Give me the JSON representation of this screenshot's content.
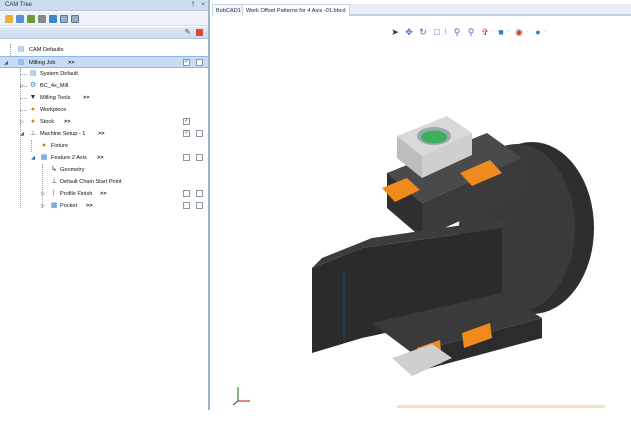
{
  "panel": {
    "title": "CAM Tree",
    "pin": "†",
    "close": "×"
  },
  "toolbar": {
    "icons": [
      "generate-icon",
      "tree-icon",
      "posted-icon",
      "tool-icon",
      "simulate-icon",
      "grid-icon",
      "list-icon"
    ]
  },
  "tree": {
    "rows": [
      {
        "label": "CAM Defaults"
      },
      {
        "label": "Milling Job",
        "arrow": ">>"
      },
      {
        "label": "System Default"
      },
      {
        "label": "BC_4x_Mill"
      },
      {
        "label": "Milling Tools",
        "arrow": ">>"
      },
      {
        "label": "Workpiece"
      },
      {
        "label": "Stock",
        "arrow": ">>"
      },
      {
        "label": "Machine Setup - 1",
        "arrow": ">>"
      },
      {
        "label": "Fixture"
      },
      {
        "label": "Feature 2 Axis",
        "arrow": ">>"
      },
      {
        "label": "Geometry"
      },
      {
        "label": "Default Chain Start Point"
      },
      {
        "label": "Profile Finish",
        "arrow": ">>"
      },
      {
        "label": "Pocket",
        "arrow": ">>"
      }
    ]
  },
  "tabs": [
    {
      "label": "BobCAD1"
    },
    {
      "label": "Work Offset Patterns for 4 Axis -01.bbcd"
    }
  ],
  "view_toolbar": {
    "icons": [
      "select-arrow-icon",
      "pan-icon",
      "rotate-icon",
      "zoom-window-icon",
      "zoom-icon",
      "zoom-fit-icon",
      "view-cube-icon",
      "shaded-icon",
      "render-mode-icon",
      "display-icon"
    ]
  },
  "colors": {
    "accent": "#2a5fb0",
    "selection": "#c9dcf5",
    "fixture_orange": "#f08a1e",
    "part_dark": "#2b2b2b",
    "tab_border": "#bdd0ea"
  }
}
